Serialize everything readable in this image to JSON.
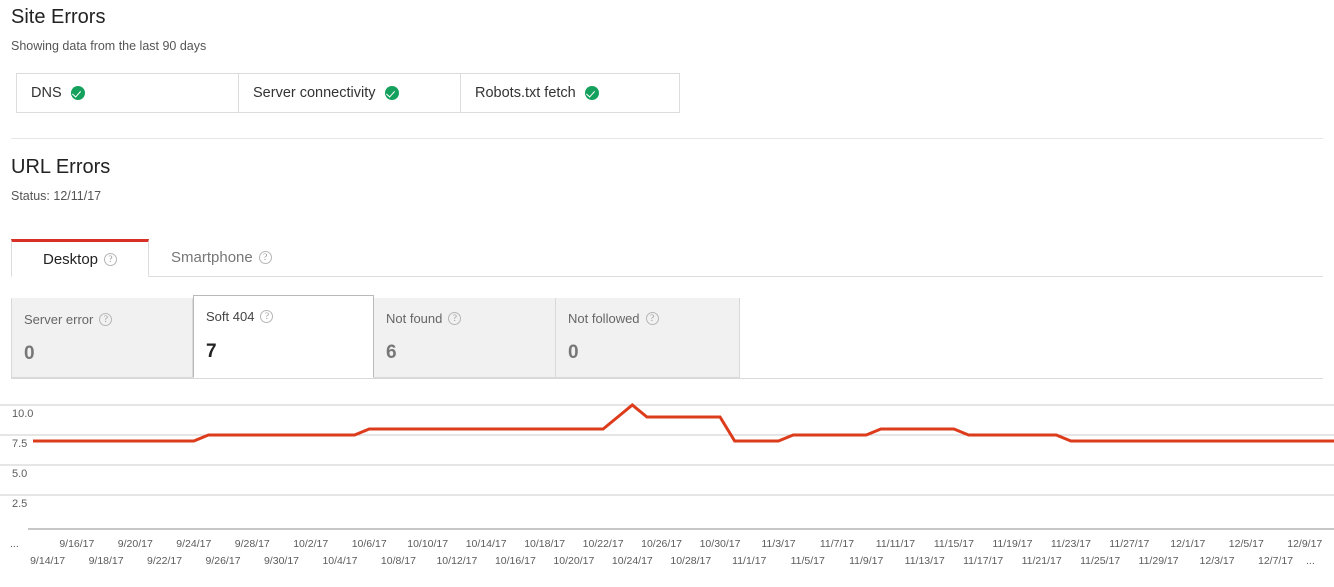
{
  "site_errors": {
    "title": "Site Errors",
    "subtitle": "Showing data from the last 90 days",
    "statuses": [
      {
        "label": "DNS",
        "state": "ok"
      },
      {
        "label": "Server connectivity",
        "state": "ok"
      },
      {
        "label": "Robots.txt fetch",
        "state": "ok"
      }
    ]
  },
  "url_errors": {
    "title": "URL Errors",
    "status": "Status: 12/11/17",
    "tabs": [
      {
        "label": "Desktop",
        "help": "?",
        "active": true
      },
      {
        "label": "Smartphone",
        "help": "?",
        "active": false
      }
    ],
    "cards": [
      {
        "label": "Server error",
        "help": "?",
        "value": "0",
        "selected": false
      },
      {
        "label": "Soft 404",
        "help": "?",
        "value": "7",
        "selected": true
      },
      {
        "label": "Not found",
        "help": "?",
        "value": "6",
        "selected": false
      },
      {
        "label": "Not followed",
        "help": "?",
        "value": "0",
        "selected": false
      }
    ]
  },
  "colors": {
    "accent_red": "#d93025",
    "line_red": "#dd3c1c",
    "ok_green": "#16a05d",
    "gridline": "#cccccc",
    "card_bg": "#f1f1f1"
  },
  "chart_data": {
    "type": "line",
    "title": "",
    "xlabel": "",
    "ylabel": "",
    "ylim": [
      0,
      11
    ],
    "yticks": [
      10.0,
      7.5,
      5.0,
      2.5
    ],
    "ytick_labels": [
      "10.0",
      "7.5",
      "5.0",
      "2.5"
    ],
    "grid": true,
    "legend": null,
    "leading_ellipsis": "...",
    "trailing_ellipsis": "...",
    "x": [
      "9/13/17",
      "9/14/17",
      "9/15/17",
      "9/16/17",
      "9/17/17",
      "9/18/17",
      "9/19/17",
      "9/20/17",
      "9/21/17",
      "9/22/17",
      "9/23/17",
      "9/24/17",
      "9/25/17",
      "9/26/17",
      "9/27/17",
      "9/28/17",
      "9/29/17",
      "9/30/17",
      "10/1/17",
      "10/2/17",
      "10/3/17",
      "10/4/17",
      "10/5/17",
      "10/6/17",
      "10/7/17",
      "10/8/17",
      "10/9/17",
      "10/10/17",
      "10/11/17",
      "10/12/17",
      "10/13/17",
      "10/14/17",
      "10/15/17",
      "10/16/17",
      "10/17/17",
      "10/18/17",
      "10/19/17",
      "10/20/17",
      "10/21/17",
      "10/22/17",
      "10/23/17",
      "10/24/17",
      "10/25/17",
      "10/26/17",
      "10/27/17",
      "10/28/17",
      "10/29/17",
      "10/30/17",
      "10/31/17",
      "11/1/17",
      "11/2/17",
      "11/3/17",
      "11/4/17",
      "11/5/17",
      "11/6/17",
      "11/7/17",
      "11/8/17",
      "11/9/17",
      "11/10/17",
      "11/11/17",
      "11/12/17",
      "11/13/17",
      "11/14/17",
      "11/15/17",
      "11/16/17",
      "11/17/17",
      "11/18/17",
      "11/19/17",
      "11/20/17",
      "11/21/17",
      "11/22/17",
      "11/23/17",
      "11/24/17",
      "11/25/17",
      "11/26/17",
      "11/27/17",
      "11/28/17",
      "11/29/17",
      "11/30/17",
      "12/1/17",
      "12/2/17",
      "12/3/17",
      "12/4/17",
      "12/5/17",
      "12/6/17",
      "12/7/17",
      "12/8/17",
      "12/9/17",
      "12/10/17",
      "12/11/17"
    ],
    "xtick_labels_upper": [
      "9/16/17",
      "9/20/17",
      "9/24/17",
      "9/28/17",
      "10/2/17",
      "10/6/17",
      "10/10/17",
      "10/14/17",
      "10/18/17",
      "10/22/17",
      "10/26/17",
      "10/30/17",
      "11/3/17",
      "11/7/17",
      "11/11/17",
      "11/15/17",
      "11/19/17",
      "11/23/17",
      "11/27/17",
      "12/1/17",
      "12/5/17",
      "12/9/17"
    ],
    "xtick_labels_lower": [
      "9/14/17",
      "9/18/17",
      "9/22/17",
      "9/26/17",
      "9/30/17",
      "10/4/17",
      "10/8/17",
      "10/12/17",
      "10/16/17",
      "10/20/17",
      "10/24/17",
      "10/28/17",
      "11/1/17",
      "11/5/17",
      "11/9/17",
      "11/13/17",
      "11/17/17",
      "11/21/17",
      "11/25/17",
      "11/29/17",
      "12/3/17",
      "12/7/17"
    ],
    "series": [
      {
        "name": "Soft 404",
        "color": "#dd3c1c",
        "values": [
          7,
          7,
          7,
          7,
          7,
          7,
          7,
          7,
          7,
          7,
          7,
          7,
          7.5,
          7.5,
          7.5,
          7.5,
          7.5,
          7.5,
          7.5,
          7.5,
          7.5,
          7.5,
          7.5,
          8,
          8,
          8,
          8,
          8,
          8,
          8,
          8,
          8,
          8,
          8,
          8,
          8,
          8,
          8,
          8,
          8,
          9,
          10,
          9,
          9,
          9,
          9,
          9,
          9,
          7,
          7,
          7,
          7,
          7.5,
          7.5,
          7.5,
          7.5,
          7.5,
          7.5,
          8,
          8,
          8,
          8,
          8,
          8,
          7.5,
          7.5,
          7.5,
          7.5,
          7.5,
          7.5,
          7.5,
          7,
          7,
          7,
          7,
          7,
          7,
          7,
          7,
          7,
          7,
          7,
          7,
          7,
          7,
          7,
          7,
          7,
          7,
          7
        ]
      }
    ]
  }
}
